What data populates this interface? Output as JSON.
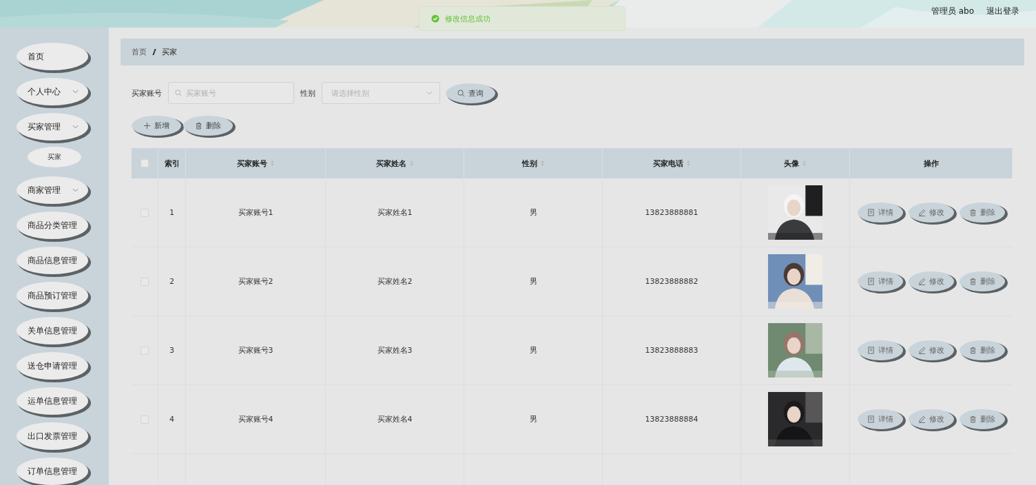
{
  "header": {
    "user": "管理员 abo",
    "logout": "退出登录"
  },
  "toast": {
    "message": "修改信息成功"
  },
  "sidebar": {
    "items": [
      {
        "label": "首页",
        "kind": "link"
      },
      {
        "label": "个人中心",
        "kind": "submenu"
      },
      {
        "label": "买家管理",
        "kind": "submenu",
        "children": [
          {
            "label": "买家",
            "selected": true
          }
        ]
      },
      {
        "label": "商家管理",
        "kind": "submenu"
      },
      {
        "label": "商品分类管理",
        "kind": "link"
      },
      {
        "label": "商品信息管理",
        "kind": "link"
      },
      {
        "label": "商品预订管理",
        "kind": "link"
      },
      {
        "label": "关单信息管理",
        "kind": "link"
      },
      {
        "label": "送仓申请管理",
        "kind": "link"
      },
      {
        "label": "运单信息管理",
        "kind": "link"
      },
      {
        "label": "出口发票管理",
        "kind": "link"
      },
      {
        "label": "订单信息管理",
        "kind": "link"
      }
    ]
  },
  "breadcrumb": [
    "首页",
    "买家"
  ],
  "search": {
    "account_label": "买家账号",
    "account_placeholder": "买家账号",
    "gender_label": "性别",
    "gender_placeholder": "请选择性别",
    "query_button": "查询"
  },
  "actions": [
    {
      "label": "新增",
      "kind": "add"
    },
    {
      "label": "删除",
      "kind": "delete"
    }
  ],
  "table": {
    "columns": [
      {
        "label": "索引",
        "kind": "plain"
      },
      {
        "label": "买家账号",
        "kind": "sortable"
      },
      {
        "label": "买家姓名",
        "kind": "sortable"
      },
      {
        "label": "性别",
        "kind": "sortable"
      },
      {
        "label": "买家电话",
        "kind": "sortable"
      },
      {
        "label": "头像",
        "kind": "sortable"
      },
      {
        "label": "操作",
        "kind": "plain"
      }
    ],
    "rows": [
      {
        "index": "1",
        "account": "买家账号1",
        "name": "买家姓名1",
        "gender": "男",
        "phone": "13823888881",
        "checked": false,
        "avatar": {
          "kind": "picture"
        },
        "actions": [
          {
            "label": "详情",
            "kind": "detail"
          },
          {
            "label": "修改",
            "kind": "edit"
          },
          {
            "label": "删除",
            "kind": "delete"
          }
        ]
      },
      {
        "index": "2",
        "account": "买家账号2",
        "name": "买家姓名2",
        "gender": "男",
        "phone": "13823888882",
        "checked": false,
        "avatar": {
          "kind": "picture"
        },
        "actions": [
          {
            "label": "详情",
            "kind": "detail"
          },
          {
            "label": "修改",
            "kind": "edit"
          },
          {
            "label": "删除",
            "kind": "delete"
          }
        ]
      },
      {
        "index": "3",
        "account": "买家账号3",
        "name": "买家姓名3",
        "gender": "男",
        "phone": "13823888883",
        "checked": false,
        "avatar": {
          "kind": "picture"
        },
        "actions": [
          {
            "label": "详情",
            "kind": "detail"
          },
          {
            "label": "修改",
            "kind": "edit"
          },
          {
            "label": "删除",
            "kind": "delete"
          }
        ]
      },
      {
        "index": "4",
        "account": "买家账号4",
        "name": "买家姓名4",
        "gender": "男",
        "phone": "13823888884",
        "checked": false,
        "avatar": {
          "kind": "picture"
        },
        "actions": [
          {
            "label": "详情",
            "kind": "detail"
          },
          {
            "label": "修改",
            "kind": "edit"
          },
          {
            "label": "删除",
            "kind": "delete"
          }
        ]
      }
    ],
    "all_checked": false
  }
}
